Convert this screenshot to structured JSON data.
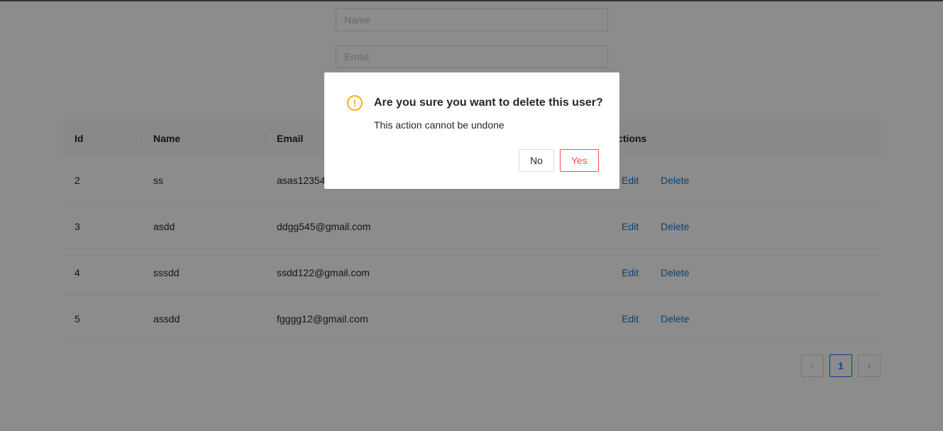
{
  "form": {
    "name_placeholder": "Name",
    "email_placeholder": "Email"
  },
  "table": {
    "headers": {
      "id": "Id",
      "name": "Name",
      "email": "Email",
      "actions": "Actions"
    },
    "rows": [
      {
        "id": "2",
        "name": "ss",
        "email": "asas123545@gmail.com",
        "edit": "Edit",
        "delete": "Delete"
      },
      {
        "id": "3",
        "name": "asdd",
        "email": "ddgg545@gmail.com",
        "edit": "Edit",
        "delete": "Delete"
      },
      {
        "id": "4",
        "name": "sssdd",
        "email": "ssdd122@gmail.com",
        "edit": "Edit",
        "delete": "Delete"
      },
      {
        "id": "5",
        "name": "assdd",
        "email": "fgggg12@gmail.com",
        "edit": "Edit",
        "delete": "Delete"
      }
    ]
  },
  "pagination": {
    "prev": "‹",
    "current": "1",
    "next": "›"
  },
  "modal": {
    "icon": "exclamation-circle-icon",
    "icon_glyph": "!",
    "title": "Are you sure you want to delete this user?",
    "content": "This action cannot be undone",
    "no_label": "No",
    "yes_label": "Yes"
  },
  "colors": {
    "link": "#1677cc",
    "warning": "#faad14",
    "danger": "#ff4d4f",
    "primary": "#1677ff"
  }
}
